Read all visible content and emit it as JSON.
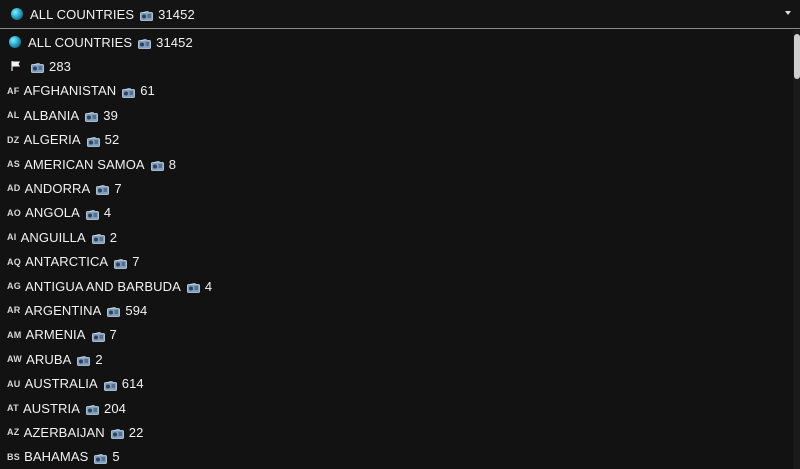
{
  "selected": {
    "label": "ALL COUNTRIES",
    "count": "31452",
    "icon": "globe-icon"
  },
  "options": [
    {
      "code": "",
      "name": "ALL COUNTRIES",
      "count": "31452",
      "icon": "globe-icon"
    },
    {
      "code": "",
      "name": "",
      "count": "283",
      "icon": "white-flag-icon"
    },
    {
      "code": "AF",
      "name": "AFGHANISTAN",
      "count": "61"
    },
    {
      "code": "AL",
      "name": "ALBANIA",
      "count": "39"
    },
    {
      "code": "DZ",
      "name": "ALGERIA",
      "count": "52"
    },
    {
      "code": "AS",
      "name": "AMERICAN SAMOA",
      "count": "8"
    },
    {
      "code": "AD",
      "name": "ANDORRA",
      "count": "7"
    },
    {
      "code": "AO",
      "name": "ANGOLA",
      "count": "4"
    },
    {
      "code": "AI",
      "name": "ANGUILLA",
      "count": "2"
    },
    {
      "code": "AQ",
      "name": "ANTARCTICA",
      "count": "7"
    },
    {
      "code": "AG",
      "name": "ANTIGUA AND BARBUDA",
      "count": "4"
    },
    {
      "code": "AR",
      "name": "ARGENTINA",
      "count": "594"
    },
    {
      "code": "AM",
      "name": "ARMENIA",
      "count": "7"
    },
    {
      "code": "AW",
      "name": "ARUBA",
      "count": "2"
    },
    {
      "code": "AU",
      "name": "AUSTRALIA",
      "count": "614"
    },
    {
      "code": "AT",
      "name": "AUSTRIA",
      "count": "204"
    },
    {
      "code": "AZ",
      "name": "AZERBAIJAN",
      "count": "22"
    },
    {
      "code": "BS",
      "name": "BAHAMAS",
      "count": "5"
    }
  ],
  "icons": {
    "count": "radio-icon",
    "dropdown": "chevron-down-icon"
  },
  "colors": {
    "background": "#121212",
    "text": "#f2f2f2",
    "radio": "#8fb4d9"
  }
}
